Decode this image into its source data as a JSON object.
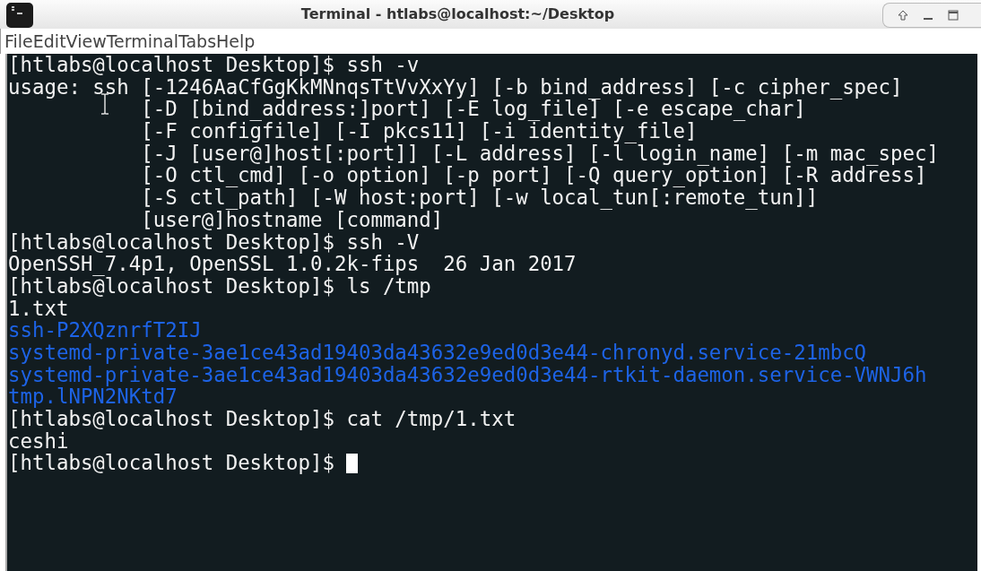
{
  "window": {
    "title": "Terminal - htlabs@localhost:~/Desktop"
  },
  "menu": [
    "File",
    "Edit",
    "View",
    "Terminal",
    "Tabs",
    "Help"
  ],
  "lines": [
    {
      "kind": "text",
      "text": "[htlabs@localhost Desktop]$ ssh -v"
    },
    {
      "kind": "text",
      "text": "usage: ssh [-1246AaCfGgKkMNnqsTtVvXxYy] [-b bind_address] [-c cipher_spec]"
    },
    {
      "kind": "continuation",
      "text": "[-D [bind_address:]port] [-E log_file] [-e escape_char]"
    },
    {
      "kind": "continuation",
      "text": "[-F configfile] [-I pkcs11] [-i identity_file]"
    },
    {
      "kind": "continuation",
      "text": "[-J [user@]host[:port]] [-L address] [-l login_name] [-m mac_spec]"
    },
    {
      "kind": "continuation",
      "text": "[-O ctl_cmd] [-o option] [-p port] [-Q query_option] [-R address]"
    },
    {
      "kind": "continuation",
      "text": "[-S ctl_path] [-W host:port] [-w local_tun[:remote_tun]]"
    },
    {
      "kind": "continuation",
      "text": "[user@]hostname [command]"
    },
    {
      "kind": "text",
      "text": "[htlabs@localhost Desktop]$ ssh -V"
    },
    {
      "kind": "text",
      "text": "OpenSSH_7.4p1, OpenSSL 1.0.2k-fips  26 Jan 2017"
    },
    {
      "kind": "text",
      "text": "[htlabs@localhost Desktop]$ ls /tmp"
    },
    {
      "kind": "text",
      "text": "1.txt"
    },
    {
      "kind": "dir",
      "text": "ssh-P2XQznrfT2IJ"
    },
    {
      "kind": "dir",
      "text": "systemd-private-3ae1ce43ad19403da43632e9ed0d3e44-chronyd.service-21mbcQ"
    },
    {
      "kind": "dir",
      "text": "systemd-private-3ae1ce43ad19403da43632e9ed0d3e44-rtkit-daemon.service-VWNJ6h"
    },
    {
      "kind": "dir",
      "text": "tmp.lNPN2NKtd7"
    },
    {
      "kind": "text",
      "text": "[htlabs@localhost Desktop]$ cat /tmp/1.txt"
    },
    {
      "kind": "text",
      "text": "ceshi"
    },
    {
      "kind": "prompt",
      "text": "[htlabs@localhost Desktop]$ "
    }
  ]
}
